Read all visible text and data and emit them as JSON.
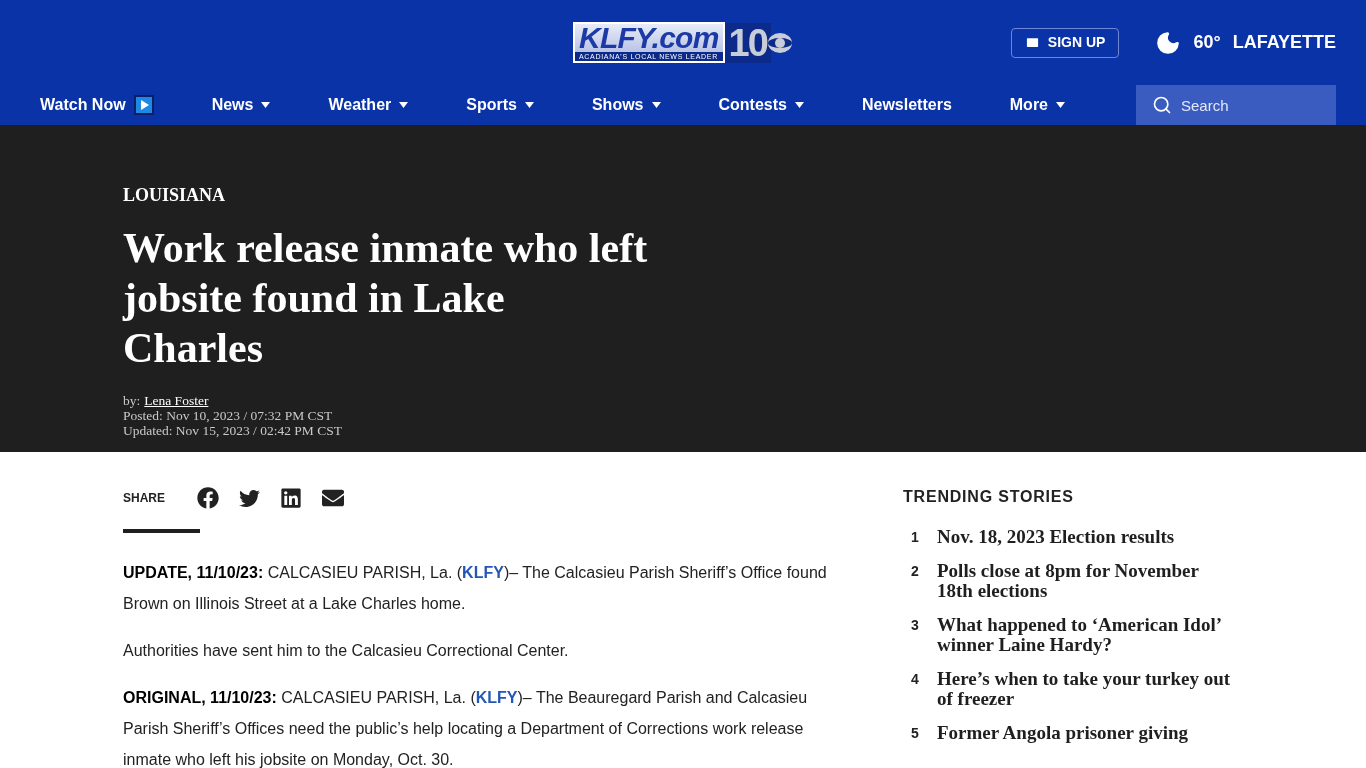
{
  "header": {
    "logo": {
      "wordmark": "KLFY.com",
      "tagline": "ACADIANA'S LOCAL NEWS LEADER",
      "channel": "10"
    },
    "signup": "SIGN UP",
    "weather": {
      "temperature": "60°",
      "city": "LAFAYETTE"
    }
  },
  "nav": {
    "items": [
      {
        "label": "Watch Now",
        "kind": "video"
      },
      {
        "label": "News",
        "kind": "dropdown"
      },
      {
        "label": "Weather",
        "kind": "dropdown"
      },
      {
        "label": "Sports",
        "kind": "dropdown"
      },
      {
        "label": "Shows",
        "kind": "dropdown"
      },
      {
        "label": "Contests",
        "kind": "dropdown"
      },
      {
        "label": "Newsletters",
        "kind": "link"
      },
      {
        "label": "More",
        "kind": "dropdown"
      }
    ],
    "search": {
      "placeholder": "Search"
    }
  },
  "article": {
    "category": "LOUISIANA",
    "title": "Work release inmate who left jobsite found in Lake Charles",
    "byline_label": "by:",
    "author": "Lena Foster",
    "posted": "Posted: Nov 10, 2023 / 07:32 PM CST",
    "updated": "Updated: Nov 15, 2023 / 02:42 PM CST",
    "share_label": "SHARE",
    "paragraphs": [
      {
        "kind": "dateline",
        "lead": "UPDATE, 11/10/23:",
        "before": " CALCASIEU PARISH, La. (",
        "link": "KLFY",
        "after": ")– The Calcasieu Parish Sheriff’s Office found Brown on Illinois Street at a Lake Charles home."
      },
      {
        "kind": "plain",
        "text": "Authorities have sent him to the Calcasieu Correctional Center."
      },
      {
        "kind": "dateline",
        "lead": "ORIGINAL, 11/10/23:",
        "before": " CALCASIEU PARISH, La. (",
        "link": "KLFY",
        "after": ")– The Beauregard Parish and Calcasieu Parish Sheriff’s Offices need the public’s help locating a Department of Corrections work release inmate who left his jobsite on Monday, Oct. 30."
      }
    ]
  },
  "trending": {
    "title": "TRENDING STORIES",
    "items": [
      {
        "number": "1",
        "title": "Nov. 18, 2023 Election results"
      },
      {
        "number": "2",
        "title": "Polls close at 8pm for November 18th elections"
      },
      {
        "number": "3",
        "title": "What happened to ‘American Idol’ winner Laine Hardy?"
      },
      {
        "number": "4",
        "title": "Here’s when to take your turkey out of freezer"
      },
      {
        "number": "5",
        "title": "Former Angola prisoner giving"
      }
    ]
  }
}
